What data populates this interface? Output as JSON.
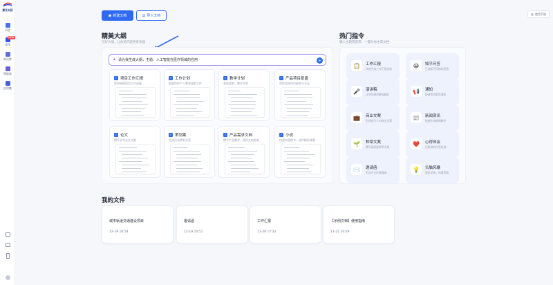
{
  "brand": {
    "name": "紫东太初"
  },
  "sidebar": {
    "items": [
      {
        "label": "问答",
        "icon": "chat-icon",
        "badge": ""
      },
      {
        "label": "写作",
        "icon": "write-icon",
        "badge": "NEW"
      },
      {
        "label": "知识库",
        "icon": "book-icon",
        "badge": ""
      },
      {
        "label": "智能体",
        "icon": "robot-icon",
        "badge": ""
      },
      {
        "label": "应用集",
        "icon": "grid-icon",
        "badge": ""
      }
    ]
  },
  "toolbar": {
    "new_doc": "新建文档",
    "import_doc": "导入文档",
    "feedback": "使用手册"
  },
  "outline": {
    "title": "精美大纲",
    "subtitle": "写好大纲，让你的内容更有条理",
    "input_value": "请为我生成大纲，主题：人工智能在医疗领域的应用",
    "templates": [
      {
        "title": "项目工作汇报",
        "desc": "帮你梳理项目工作进展"
      },
      {
        "title": "工作计划",
        "desc": "根据你的个人需求规划工作"
      },
      {
        "title": "教学计划",
        "desc": "有效规划，教学不慌"
      },
      {
        "title": "产品项目复盘",
        "desc": "帮你总结项目经验与不足"
      },
      {
        "title": "论文",
        "desc": "撰写学术论文大纲"
      },
      {
        "title": "策划案",
        "desc": "生成活动策划方案"
      },
      {
        "title": "产品需求文档",
        "desc": "撰写产品需求，提供文档框架"
      },
      {
        "title": "小说",
        "desc": "快速构思情节，创作精彩故事"
      }
    ]
  },
  "hot": {
    "title": "热门指令",
    "subtitle": "输入主题或要求，一键为你生成文档",
    "items": [
      {
        "title": "工作汇报",
        "desc": "快速生成工作汇报文档",
        "icon": "📋"
      },
      {
        "title": "知乎问答",
        "desc": "生成知乎风格的回答",
        "icon": "😀"
      },
      {
        "title": "演讲稿",
        "desc": "让你的演讲更加精彩",
        "icon": "🎤"
      },
      {
        "title": "通知",
        "desc": "快速生成各类通知",
        "icon": "📢"
      },
      {
        "title": "商业文案",
        "desc": "生成吸引人的商业文案",
        "icon": "💼"
      },
      {
        "title": "新闻资讯",
        "desc": "快速生成新闻稿件",
        "icon": "📰"
      },
      {
        "title": "种草文案",
        "desc": "撰写高质量种草文案",
        "icon": "🌱"
      },
      {
        "title": "心得体会",
        "desc": "记录你的所思所感",
        "icon": "❤️"
      },
      {
        "title": "邀请函",
        "desc": "生成正式的邀请函",
        "icon": "✉️"
      },
      {
        "title": "头脑风暴",
        "desc": "激发灵感，拓展思路",
        "icon": "💡"
      }
    ]
  },
  "files": {
    "title": "我的文件",
    "items": [
      {
        "name": "城市轨道交通建设项目",
        "date": "12-19 10:54"
      },
      {
        "name": "邀请函",
        "date": "12-19 10:51"
      },
      {
        "name": "工作汇报",
        "date": "11-28 17:22"
      },
      {
        "name": "【示例文档】使用指南",
        "date": "11-22 10:29"
      }
    ]
  },
  "colors": {
    "accent": "#2f6bf1",
    "ai_border": "#a88ce8",
    "card_bg": "#eef2fd"
  }
}
